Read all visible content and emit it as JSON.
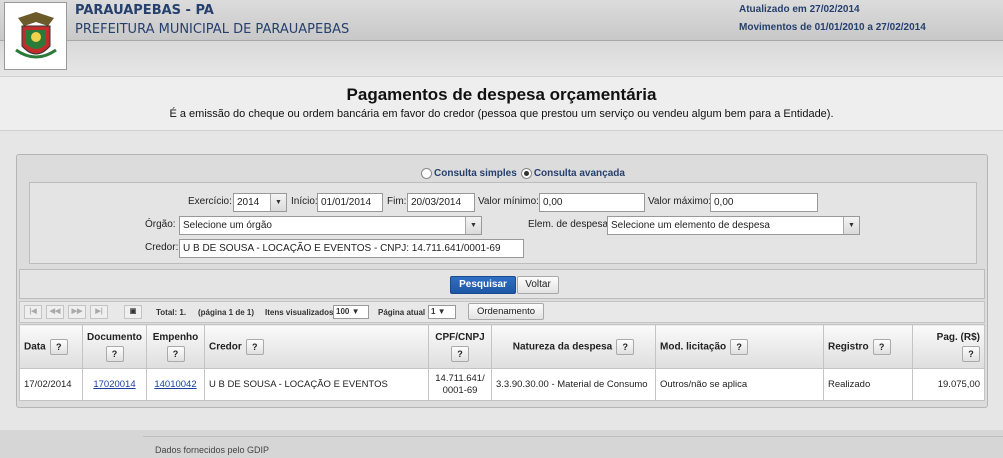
{
  "header": {
    "city": "PARAUAPEBAS - PA",
    "entity": "PREFEITURA MUNICIPAL DE PARAUAPEBAS",
    "updated": "Atualizado em 27/02/2014",
    "movements": "Movimentos de 01/01/2010 a 27/02/2014",
    "logo_icon": "coat-of-arms-icon"
  },
  "page": {
    "title": "Pagamentos de despesa orçamentária",
    "subtitle": "É a emissão do cheque ou ordem bancária em favor do credor (pessoa que prestou um serviço ou vendeu algum bem para a Entidade)."
  },
  "mode": {
    "simple": "Consulta simples",
    "advanced": "Consulta avançada",
    "selected": "advanced"
  },
  "filters": {
    "exercicio_label": "Exercício:",
    "exercicio_value": "2014",
    "inicio_label": "Início:",
    "inicio_value": "01/01/2014",
    "fim_label": "Fim:",
    "fim_value": "20/03/2014",
    "valor_min_label": "Valor mínimo:",
    "valor_min_value": "0,00",
    "valor_max_label": "Valor máximo:",
    "valor_max_value": "0,00",
    "orgao_label": "Órgão:",
    "orgao_value": "Selecione um órgão",
    "elem_label": "Elem. de despesa:",
    "elem_value": "Selecione um elemento de despesa",
    "credor_label": "Credor:",
    "credor_value": "U B DE SOUSA - LOCAÇÃO E EVENTOS - CNPJ: 14.711.641/0001-69"
  },
  "actions": {
    "search": "Pesquisar",
    "back": "Voltar"
  },
  "pager": {
    "total": "Total: 1.",
    "page_info": "(página 1 de 1)",
    "items_label": "Itens visualizados",
    "items_value": "100",
    "current_label": "Página atual",
    "current_value": "1",
    "order_button": "Ordenamento"
  },
  "table": {
    "help": "?",
    "columns": [
      "Data",
      "Documento",
      "Empenho",
      "Credor",
      "CPF/CNPJ",
      "Natureza da despesa",
      "Mod. licitação",
      "Registro",
      "Pag. (R$)"
    ],
    "rows": [
      {
        "data": "17/02/2014",
        "documento": "17020014",
        "empenho": "14010042",
        "credor": "U B DE SOUSA - LOCAÇÃO E EVENTOS",
        "cnpj_1": "14.711.641/",
        "cnpj_2": "0001-69",
        "natureza": "3.3.90.30.00 - Material de Consumo",
        "modalidade": "Outros/não se aplica",
        "registro": "Realizado",
        "pagamento": "19.075,00"
      }
    ]
  },
  "footer": {
    "text": "Dados fornecidos pelo GDIP"
  }
}
